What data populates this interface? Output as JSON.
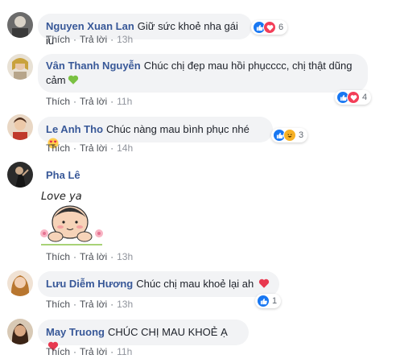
{
  "comments": [
    {
      "name": "Nguyen Xuan Lan",
      "text": "Giữ sức khoẻ nha gái iu",
      "like": "Thích",
      "reply": "Trả lời",
      "time": "13h",
      "reaction_count": "6",
      "reaction_icons": [
        "like-icon",
        "love-icon"
      ]
    },
    {
      "name": "Vân Thanh Nguyễn",
      "text": "Chúc chị đẹp mau hồi phụcccc, chị thật dũng cảm",
      "text_line1": "Chúc chị đẹp mau hồi phụcccc, chị thật dũng",
      "text_line2": "cảm",
      "like": "Thích",
      "reply": "Trả lời",
      "time": "11h",
      "reaction_count": "4",
      "reaction_icons": [
        "like-icon",
        "love-icon"
      ],
      "emoji": "green-heart"
    },
    {
      "name": "Le Anh Tho",
      "text": "Chúc nàng mau bình phục nhé",
      "like": "Thích",
      "reply": "Trả lời",
      "time": "14h",
      "reaction_count": "3",
      "reaction_icons": [
        "like-icon",
        "haha-icon"
      ],
      "emoji": "heart-eyes"
    },
    {
      "name": "Pha Lê",
      "sticker_text": "Love ya",
      "like": "Thích",
      "reply": "Trả lời",
      "time": "13h"
    },
    {
      "name": "Lưu Diễm Hương",
      "text": "Chúc chị mau khoẻ lại ah",
      "like": "Thích",
      "reply": "Trả lời",
      "time": "13h",
      "reaction_count": "1",
      "reaction_icons": [
        "like-icon"
      ],
      "emoji": "red-heart"
    },
    {
      "name": "May Truong",
      "text": "CHÚC CHỊ MAU KHOẺ Ạ",
      "like": "Thích",
      "reply": "Trả lời",
      "time": "11h",
      "emoji": "red-heart"
    }
  ],
  "sep": "·",
  "colors": {
    "name": "#385898",
    "bubble": "#f2f3f5",
    "like": "#1877f2",
    "love": "#f33e58",
    "haha": "#f7b125"
  }
}
